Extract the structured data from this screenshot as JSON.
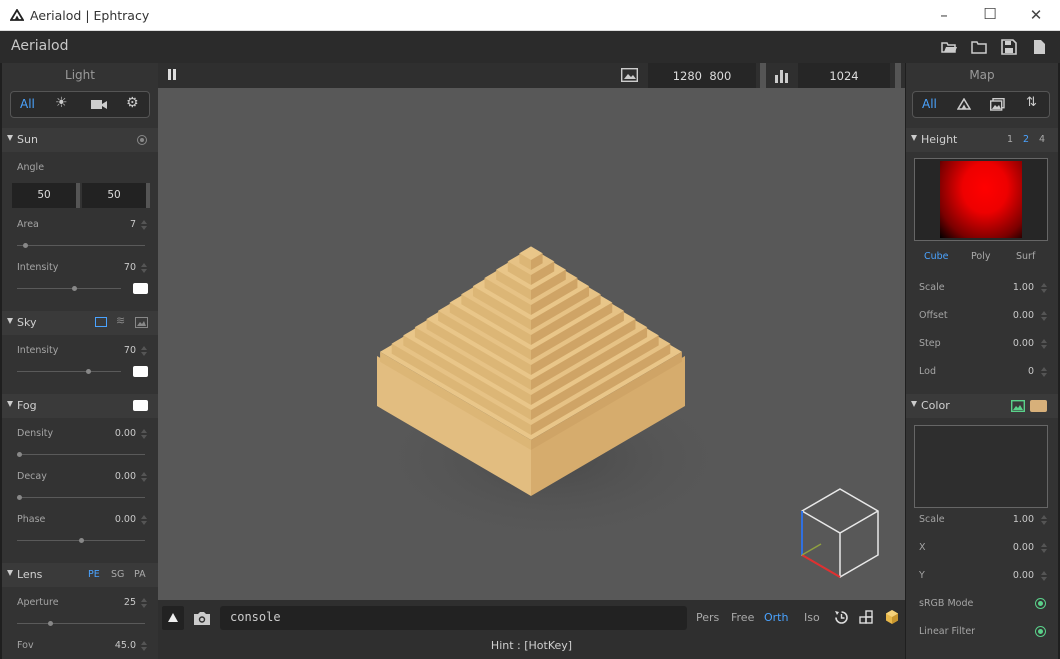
{
  "window": {
    "title": "Aerialod | Ephtracy"
  },
  "app": {
    "name": "Aerialod"
  },
  "left": {
    "title": "Light",
    "tab_all": "All",
    "sun": {
      "title": "Sun",
      "angle_label": "Angle",
      "angle_a": "50",
      "angle_b": "50",
      "area_label": "Area",
      "area_value": "7",
      "area_level": 0.05,
      "intensity_label": "Intensity",
      "intensity_value": "70",
      "intensity_level": 0.56
    },
    "sky": {
      "title": "Sky",
      "intensity_label": "Intensity",
      "intensity_value": "70",
      "intensity_level": 0.7
    },
    "fog": {
      "title": "Fog",
      "density_label": "Density",
      "density_value": "0.00",
      "density_level": 0.0,
      "decay_label": "Decay",
      "decay_value": "0.00",
      "decay_level": 0.0,
      "phase_label": "Phase",
      "phase_value": "0.00",
      "phase_level": 0.5
    },
    "lens": {
      "title": "Lens",
      "opt_pe": "PE",
      "opt_sg": "SG",
      "opt_pa": "PA",
      "aperture_label": "Aperture",
      "aperture_value": "25",
      "aperture_level": 0.25,
      "fov_label": "Fov",
      "fov_value": "45.0"
    }
  },
  "viewport": {
    "width": "1280",
    "height": "800",
    "samples": "1024"
  },
  "bottom": {
    "console_text": "console",
    "modes": [
      "Pers",
      "Free",
      "Orth",
      "Iso"
    ],
    "active_mode": "Orth",
    "hint": "Hint : [HotKey]"
  },
  "right": {
    "title": "Map",
    "tab_all": "All",
    "height": {
      "title": "Height",
      "lod1": "1",
      "lod2": "2",
      "lod4": "4",
      "view_cube": "Cube",
      "view_poly": "Poly",
      "view_surf": "Surf",
      "scale_label": "Scale",
      "scale_value": "1.00",
      "offset_label": "Offset",
      "offset_value": "0.00",
      "step_label": "Step",
      "step_value": "0.00",
      "lod_label": "Lod",
      "lod_value": "0"
    },
    "color": {
      "title": "Color",
      "scale_label": "Scale",
      "scale_value": "1.00",
      "x_label": "X",
      "x_value": "0.00",
      "y_label": "Y",
      "y_value": "0.00",
      "srgb_label": "sRGB Mode",
      "linear_label": "Linear Filter"
    }
  },
  "colors": {
    "accent": "#4aa3ff",
    "model": "#e8c487",
    "swatch_tan": "#d7b07a",
    "check": "#5ad18a"
  }
}
